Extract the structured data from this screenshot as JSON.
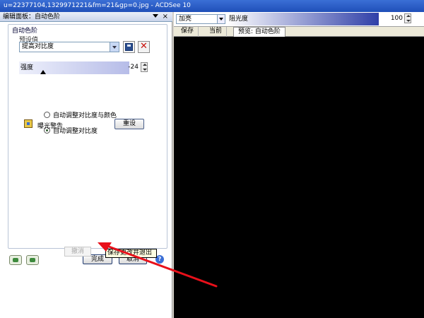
{
  "window": {
    "title": "u=2237710​4,1329971221&fm=21&gp=0.jpg - ACDSee 10"
  },
  "panel": {
    "header": "编辑面板：自动色阶",
    "close_glyph": "×",
    "group_title": "自动色阶",
    "preset_label": "预设值",
    "preset_value": "提高对比度",
    "delete_glyph": "✕",
    "strength_label": "强度",
    "strength_value": "-24",
    "strength_level_percent": 20,
    "options": [
      {
        "label": "自动调整对比度与颜色",
        "selected": false
      },
      {
        "label": "自动调整对比度",
        "selected": true
      }
    ],
    "exposure_warning": "曝光警告",
    "reset_label": "重设",
    "done_label": "完成",
    "cancel_label": "取消",
    "help_glyph": "?",
    "undo_label": "撤消",
    "tooltip": "保存更改并退出"
  },
  "toolbar": {
    "blend_mode": "加亮",
    "opacity_label": "阻光度",
    "opacity_value": "100"
  },
  "tabs": [
    "保存",
    "当前",
    "预览: 自动色阶"
  ],
  "colors": {
    "accent": "#3b6fd6",
    "preview_bg": "#000000",
    "tooltip_bg": "#ffffe1"
  }
}
